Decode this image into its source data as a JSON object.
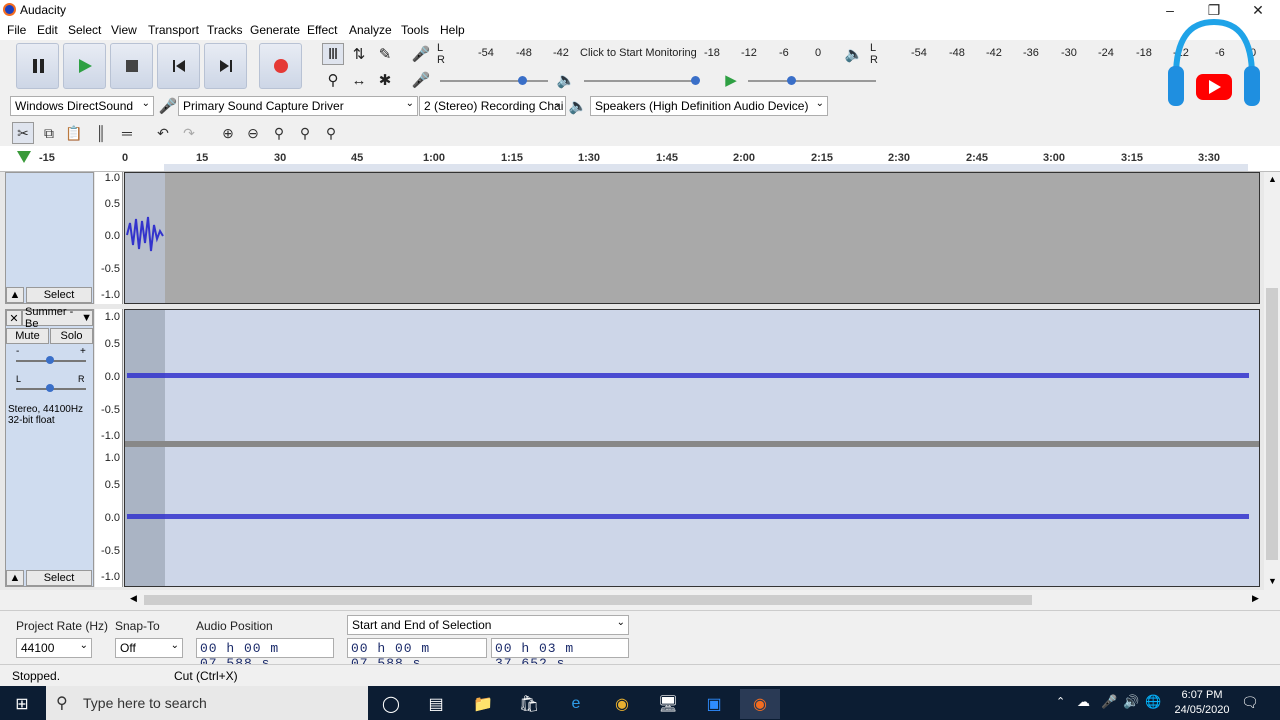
{
  "window": {
    "title": "Audacity"
  },
  "menu": [
    "File",
    "Edit",
    "Select",
    "View",
    "Transport",
    "Tracks",
    "Generate",
    "Effect",
    "Analyze",
    "Tools",
    "Help"
  ],
  "transport": {
    "pause": "pause-icon",
    "play": "play-icon",
    "stop": "stop-icon",
    "skip_start": "skip-start-icon",
    "skip_end": "skip-end-icon",
    "record": "record-icon"
  },
  "meter": {
    "record_scale": [
      "-54",
      "-48",
      "-42",
      "Click to Start Monitoring",
      "-18",
      "-12",
      "-6",
      "0"
    ],
    "play_scale": [
      "-54",
      "-48",
      "-42",
      "-36",
      "-30",
      "-24",
      "-18",
      "-12",
      "-6",
      "0"
    ],
    "channels": [
      "L",
      "R"
    ]
  },
  "devices": {
    "host": "Windows DirectSound",
    "input": "Primary Sound Capture Driver",
    "channels": "2 (Stereo) Recording Chai",
    "output": "Speakers (High Definition Audio Device)"
  },
  "ruler": {
    "labels": [
      "-15",
      "0",
      "15",
      "30",
      "45",
      "1:00",
      "1:15",
      "1:30",
      "1:45",
      "2:00",
      "2:15",
      "2:30",
      "2:45",
      "3:00",
      "3:15",
      "3:30"
    ]
  },
  "track1": {
    "select_label": "Select",
    "scale": [
      "1.0",
      "0.5",
      "0.0",
      "-0.5",
      "-1.0"
    ]
  },
  "track2": {
    "name": "Summer - Be",
    "mute": "Mute",
    "solo": "Solo",
    "info_line1": "Stereo, 44100Hz",
    "info_line2": "32-bit float",
    "select_label": "Select",
    "scale": [
      "1.0",
      "0.5",
      "0.0",
      "-0.5",
      "-1.0"
    ],
    "pan_left": "L",
    "pan_right": "R",
    "gain_minus": "-",
    "gain_plus": "+"
  },
  "bottom": {
    "project_rate_label": "Project Rate (Hz)",
    "project_rate": "44100",
    "snap_label": "Snap-To",
    "snap_value": "Off",
    "audio_pos_label": "Audio Position",
    "audio_pos": "00 h 00 m 07.588 s",
    "selection_mode": "Start and End of Selection",
    "sel_start": "00 h 00 m 07.588 s",
    "sel_end": "00 h 03 m 37.652 s"
  },
  "status": {
    "state": "Stopped.",
    "hint": "Cut (Ctrl+X)"
  },
  "taskbar": {
    "search_placeholder": "Type here to search",
    "time": "6:07 PM",
    "date": "24/05/2020"
  },
  "colors": {
    "wave": "#3333cc",
    "record": "#e53935",
    "play": "#2ea043",
    "track_bg": "#cdd6e8"
  }
}
